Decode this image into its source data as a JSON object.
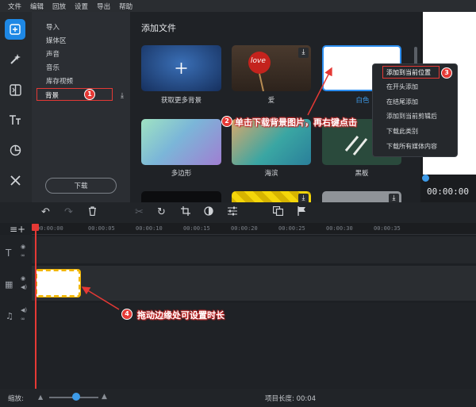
{
  "menu": [
    "文件",
    "编辑",
    "回放",
    "设置",
    "导出",
    "帮助"
  ],
  "sidebar": {
    "categories": [
      "导入",
      "媒体区",
      "声音",
      "音乐",
      "库存视频",
      "背景"
    ],
    "download_button": "下载"
  },
  "content": {
    "title": "添加文件",
    "tiles": [
      {
        "label": "获取更多背景"
      },
      {
        "label": "爱",
        "image_text": "love"
      },
      {
        "label": "白色"
      },
      {
        "label": "多边形"
      },
      {
        "label": "海滨"
      },
      {
        "label": "黑板"
      }
    ]
  },
  "context_menu": {
    "items": [
      "添加到当前位置",
      "在开头添加",
      "在结尾添加",
      "添加到当前剪辑后",
      "下载此类别",
      "下载所有媒体内容"
    ]
  },
  "preview": {
    "time": "00:00:00"
  },
  "ruler": {
    "ticks": [
      "00:00:00",
      "00:00:05",
      "00:00:10",
      "00:00:15",
      "00:00:20",
      "00:00:25",
      "00:00:30",
      "00:00:35"
    ]
  },
  "statusbar": {
    "zoom_label": "缩放:",
    "project_length": "项目长度: 00:04"
  },
  "annotations": {
    "badges": [
      "1",
      "2",
      "3",
      "4"
    ],
    "note2": "单击下载背景图片，再右键点击",
    "note4": "拖动边缘处可设置时长"
  },
  "colors": {
    "accent": "#1e88e5",
    "highlight": "#e53935",
    "clip_border": "#f2b705"
  }
}
